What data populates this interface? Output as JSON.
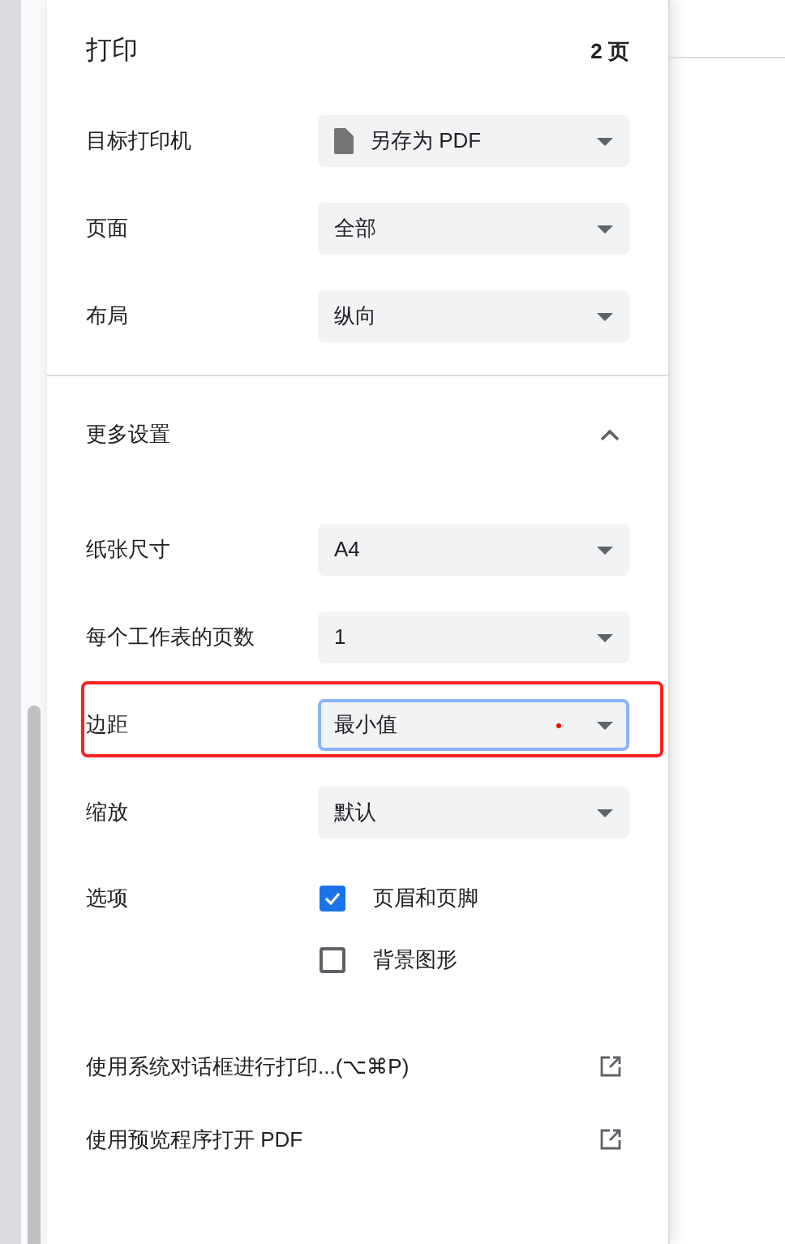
{
  "header": {
    "title": "打印",
    "page_count": "2 页"
  },
  "settings": [
    {
      "label": "目标打印机",
      "value": "另存为 PDF",
      "kind": "file"
    },
    {
      "label": "页面",
      "value": "全部",
      "kind": "plain"
    },
    {
      "label": "布局",
      "value": "纵向",
      "kind": "plain"
    }
  ],
  "more_settings": {
    "label": "更多设置",
    "expanded": true
  },
  "more": [
    {
      "label": "纸张尺寸",
      "value": "A4",
      "focused": false,
      "highlighted": false
    },
    {
      "label": "每个工作表的页数",
      "value": "1",
      "focused": false,
      "highlighted": false
    },
    {
      "label": "边距",
      "value": "最小值",
      "focused": true,
      "highlighted": true
    },
    {
      "label": "缩放",
      "value": "默认",
      "focused": false,
      "highlighted": false
    }
  ],
  "options": {
    "label": "选项",
    "items": [
      {
        "label": "页眉和页脚",
        "checked": true
      },
      {
        "label": "背景图形",
        "checked": false
      }
    ]
  },
  "links": [
    "使用系统对话框进行打印...(⌥⌘P)",
    "使用预览程序打开 PDF"
  ]
}
